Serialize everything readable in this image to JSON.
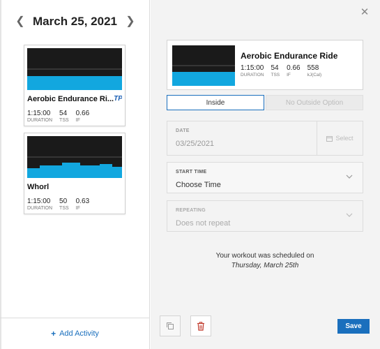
{
  "calendar": {
    "date_title": "March 25, 2021",
    "add_activity_label": "Add Activity"
  },
  "workouts": [
    {
      "title": "Aerobic Endurance Ri...",
      "badge": "TP",
      "duration": "1:15:00",
      "duration_label": "DURATION",
      "tss": "54",
      "tss_label": "TSS",
      "if": "0.66",
      "if_label": "IF"
    },
    {
      "title": "Whorl",
      "badge": "",
      "duration": "1:15:00",
      "duration_label": "DURATION",
      "tss": "50",
      "tss_label": "TSS",
      "if": "0.63",
      "if_label": "IF"
    }
  ],
  "detail": {
    "title": "Aerobic Endurance Ride",
    "duration": "1:15:00",
    "duration_label": "DURATION",
    "tss": "54",
    "tss_label": "TSS",
    "if": "0.66",
    "if_label": "IF",
    "kj": "558",
    "kj_label": "kJ(Cal)",
    "toggle_inside": "Inside",
    "toggle_outside": "No Outside Option",
    "date_label": "DATE",
    "date_value": "03/25/2021",
    "date_select": "Select",
    "start_time_label": "START TIME",
    "start_time_value": "Choose Time",
    "repeating_label": "REPEATING",
    "repeating_value": "Does not repeat",
    "scheduled_msg": "Your workout was scheduled on",
    "scheduled_date": "Thursday, March 25th",
    "save_label": "Save"
  },
  "colors": {
    "accent": "#1a6fbd",
    "graph_bg": "#1a1a1a",
    "graph_fill": "#12a7df",
    "delete": "#c0392b"
  }
}
